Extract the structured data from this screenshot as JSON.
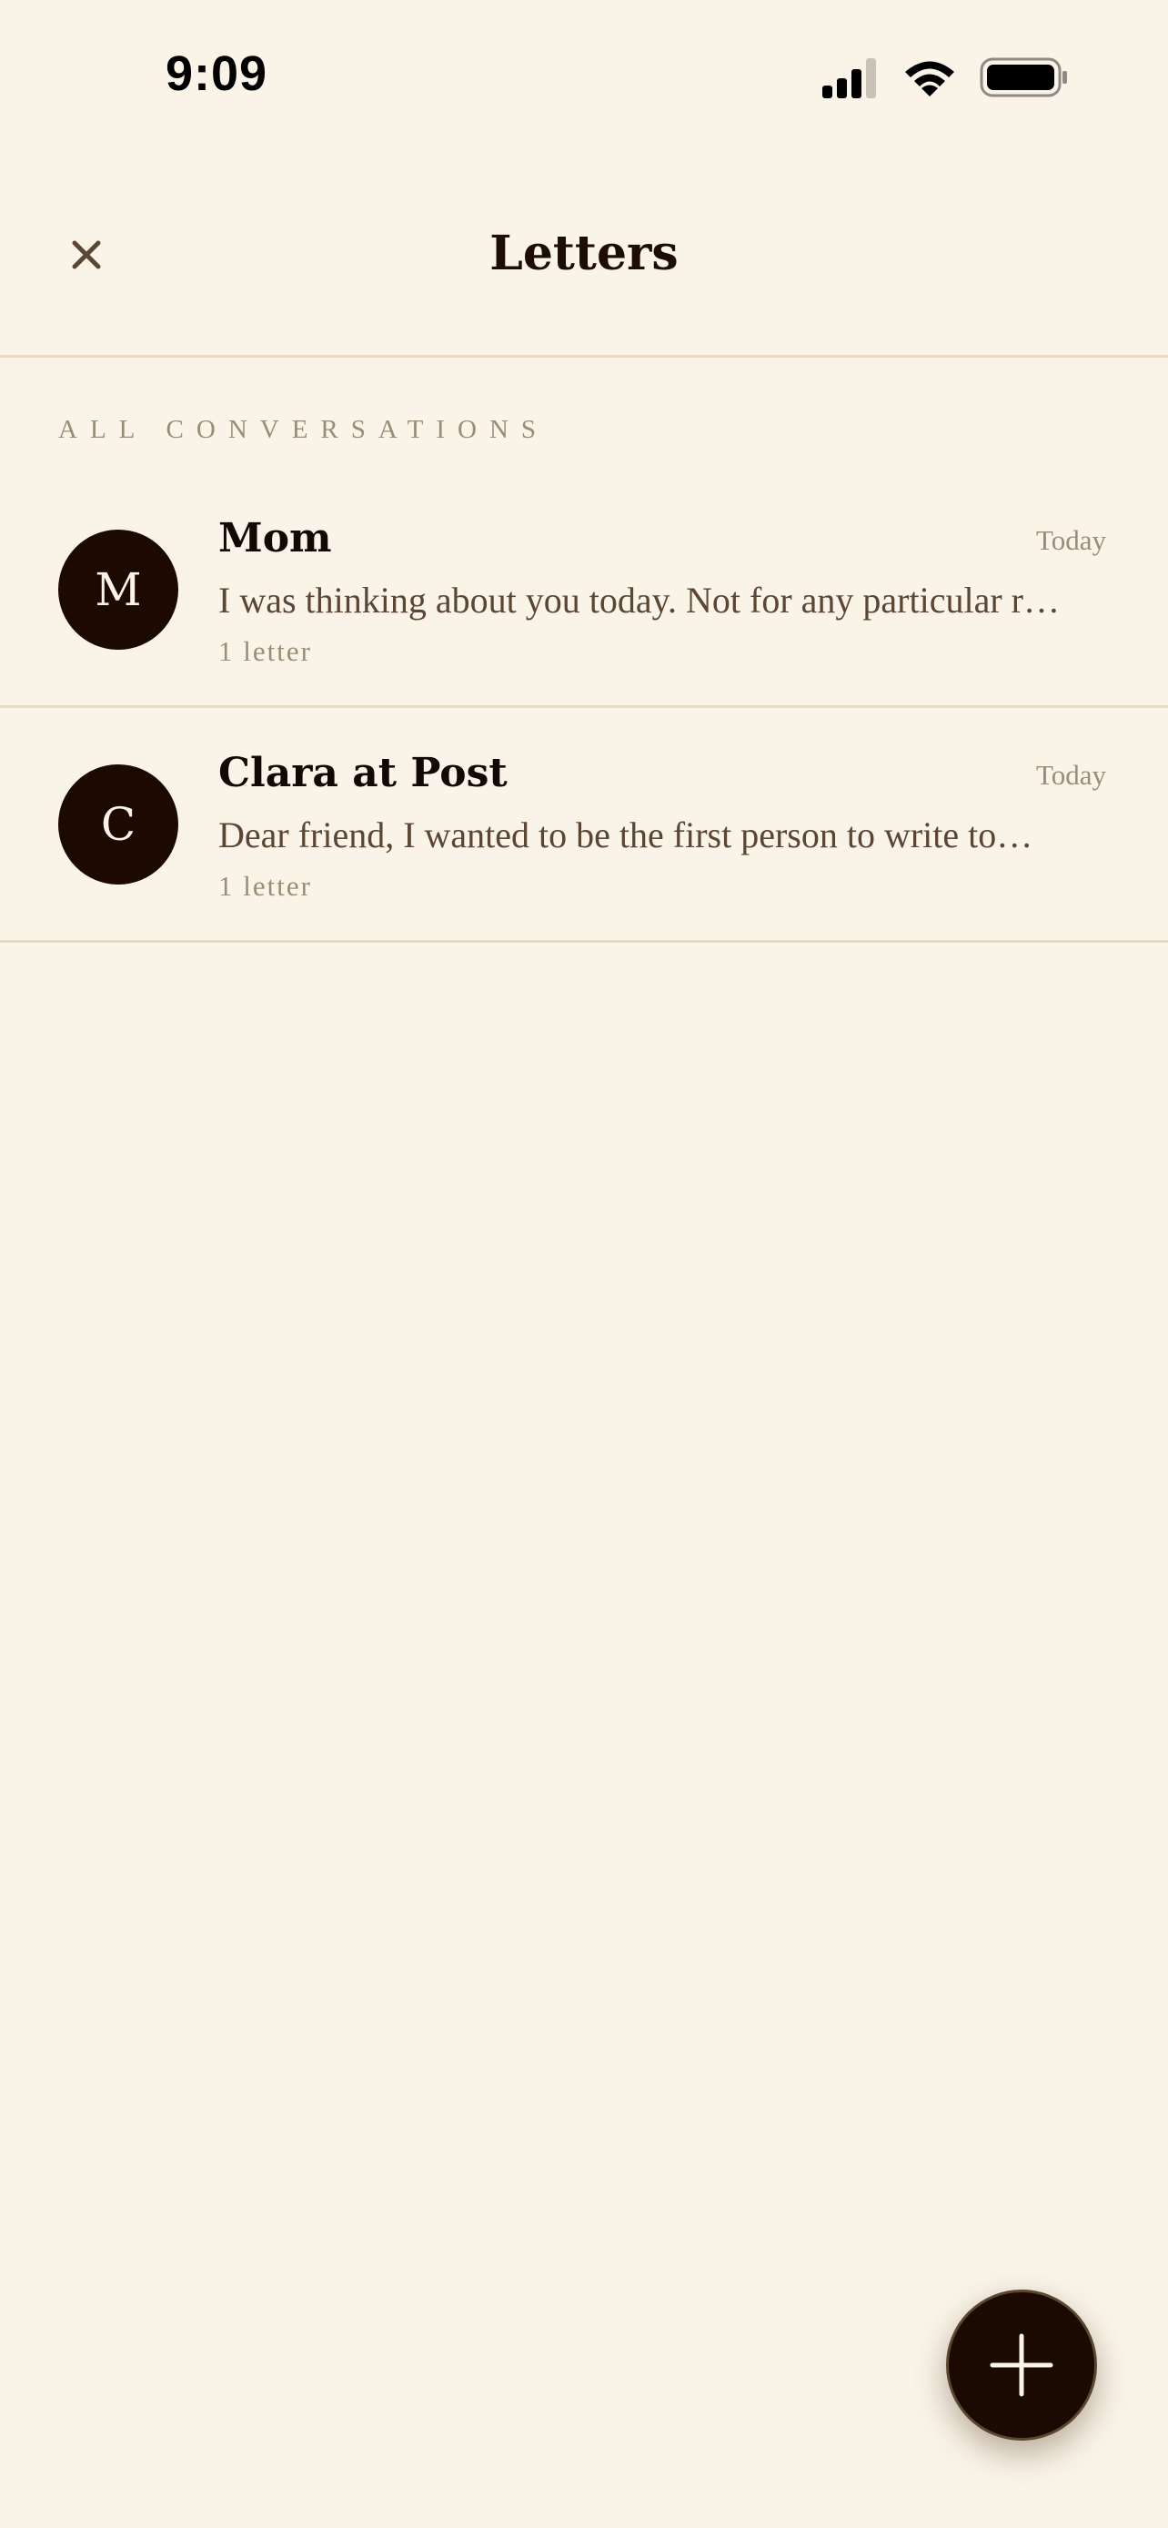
{
  "status_bar": {
    "time": "9:09"
  },
  "header": {
    "title": "Letters",
    "close_icon": "close-icon"
  },
  "section": {
    "label": "ALL CONVERSATIONS"
  },
  "conversations": [
    {
      "initial": "M",
      "name": "Mom",
      "date": "Today",
      "preview": "I was thinking about you today. Not for any particular r…",
      "count": "1 letter"
    },
    {
      "initial": "C",
      "name": "Clara at Post",
      "date": "Today",
      "preview": "Dear friend, I wanted to be the first person to write to…",
      "count": "1 letter"
    }
  ],
  "fab": {
    "icon": "plus-icon"
  },
  "colors": {
    "background": "#FAF4E8",
    "ink": "#1C0E07",
    "muted": "#9A8D77",
    "preview": "#5B4633",
    "divider": "#E6DBBF",
    "avatar": "#1C0A02"
  }
}
